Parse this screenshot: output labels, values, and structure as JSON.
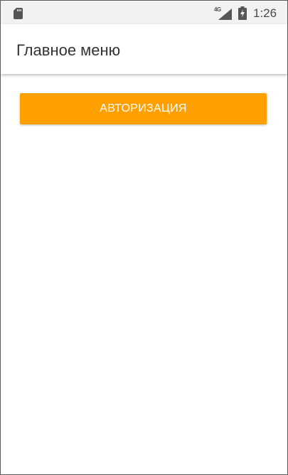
{
  "status_bar": {
    "sd_icon": "sd-card-icon",
    "network_label": "4G",
    "signal_icon": "signal-icon",
    "battery_icon": "battery-charging-icon",
    "time": "1:26"
  },
  "app_bar": {
    "title": "Главное меню"
  },
  "main": {
    "auth_button_label": "АВТОРИЗАЦИЯ"
  },
  "colors": {
    "accent": "#ff9f00",
    "status_bar_bg": "#f2f2f2",
    "title_text": "#333333"
  }
}
